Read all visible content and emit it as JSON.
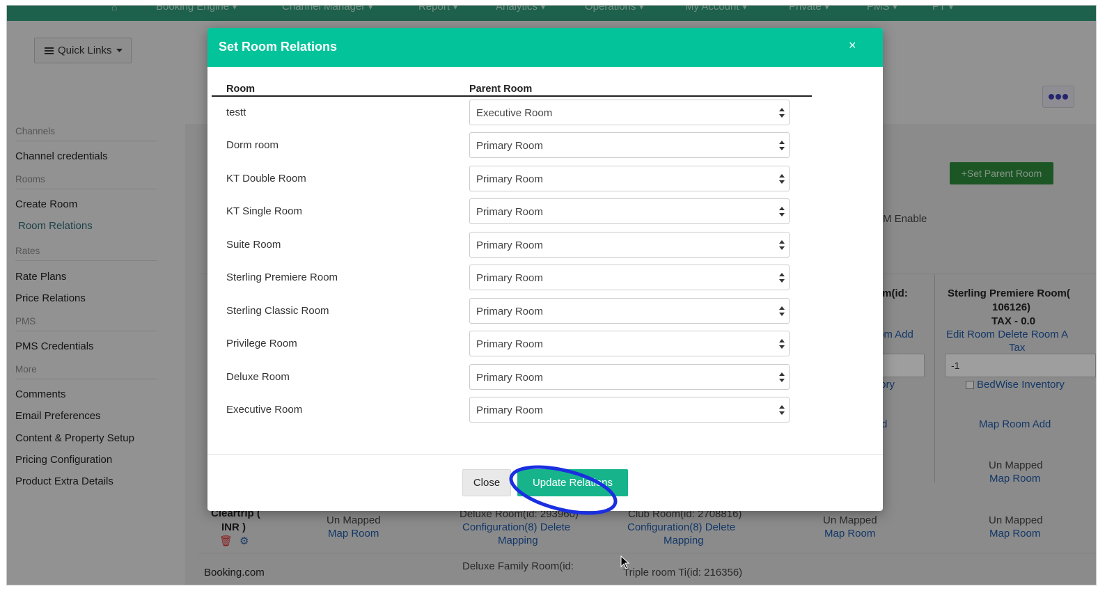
{
  "topnav": {
    "items": [
      "Booking Engine ▾",
      "Channel Manager ▾",
      "Report ▾",
      "Analytics ▾",
      "Operations ▾",
      "My Account ▾",
      "Private ▾",
      "PMS ▾",
      "PT ▾"
    ]
  },
  "quick_links": {
    "label": "Quick Links"
  },
  "sidebar": {
    "sections": {
      "channels": "Channels",
      "rooms": "Rooms",
      "rates": "Rates",
      "pms": "PMS",
      "more": "More"
    },
    "links": {
      "channel_credentials": "Channel credentials",
      "create_room": "Create Room",
      "room_relations": "Room Relations",
      "rate_plans": "Rate Plans",
      "price_relations": "Price Relations",
      "pms_credentials": "PMS Credentials",
      "comments": "Comments",
      "email_preferences": "Email Preferences",
      "content_property_setup": "Content & Property Setup",
      "pricing_configuration": "Pricing Configuration",
      "product_extra_details": "Product Extra Details"
    }
  },
  "background": {
    "set_parent_room": "+Set Parent Room",
    "m_enable": "M Enable",
    "col_partial_title": "om(id:",
    "col_partial_links": "om Add",
    "col_partial_inventory": "tory",
    "col_partial_d": "d",
    "sterling_title_1": "Sterling Premiere Room(",
    "sterling_title_2": "106126)",
    "sterling_tax": "TAX - 0.0",
    "sterling_links_1": "Edit Room Delete Room A",
    "sterling_links_2": "Tax",
    "sterling_input": "-1",
    "bedwise": "BedWise Inventory",
    "map_room_add": "Map Room Add",
    "un_mapped": "Un Mapped",
    "map_room": "Map Room",
    "cleartrip_1": "Cleartrip (",
    "cleartrip_2": "INR )",
    "deluxe_room_id": "Deluxe Room(id: 293960)",
    "configuration_delete": "Configuration(8) Delete",
    "mapping": "Mapping",
    "club_room_id": "Club Room(id: 2708816)",
    "deluxe_family": "Deluxe Family Room(id:",
    "triple_room": "Triple room Ti(id: 216356)",
    "booking_com": "Booking.com"
  },
  "modal": {
    "title": "Set Room Relations",
    "close_icon": "×",
    "columns": {
      "room": "Room",
      "parent_room": "Parent Room"
    },
    "rows": [
      {
        "room": "testt",
        "parent": "Executive Room"
      },
      {
        "room": "Dorm room",
        "parent": "Primary Room"
      },
      {
        "room": "KT Double Room",
        "parent": "Primary Room"
      },
      {
        "room": "KT Single Room",
        "parent": "Primary Room"
      },
      {
        "room": "Suite Room",
        "parent": "Primary Room"
      },
      {
        "room": "Sterling Premiere Room",
        "parent": "Primary Room"
      },
      {
        "room": "Sterling Classic Room",
        "parent": "Primary Room"
      },
      {
        "room": "Privilege Room",
        "parent": "Primary Room"
      },
      {
        "room": "Deluxe Room",
        "parent": "Primary Room"
      },
      {
        "room": "Executive Room",
        "parent": "Primary Room"
      }
    ],
    "close_button": "Close",
    "update_button": "Update Relations"
  },
  "colors": {
    "modal_header": "#03c39b",
    "update_button": "#17b48c",
    "annotation": "#1a2fe0",
    "nav": "#2f9c7a"
  }
}
